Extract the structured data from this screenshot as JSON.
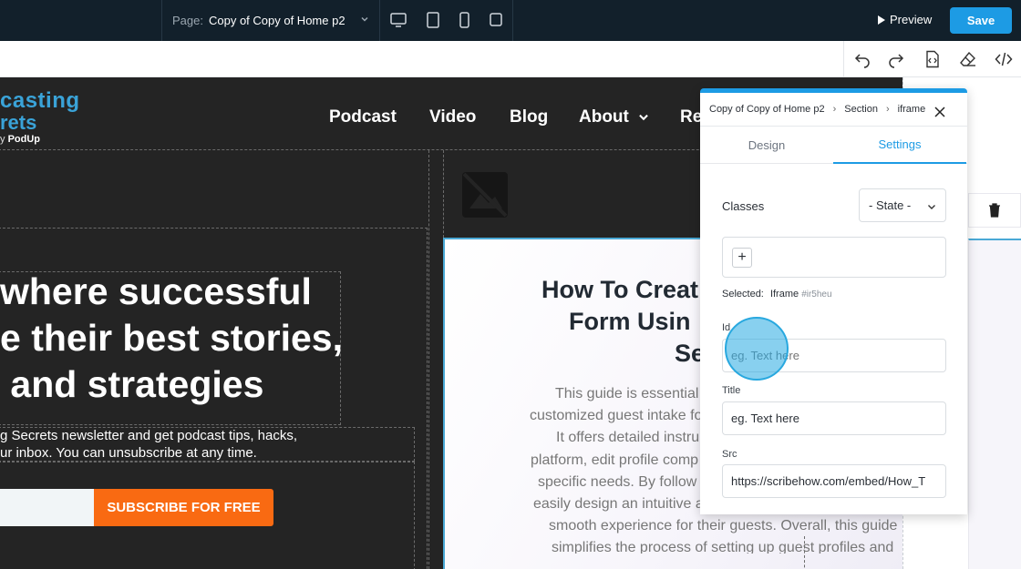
{
  "topbar": {
    "page_label": "Page:",
    "page_name": "Copy of Copy of Home p2",
    "preview_label": "Preview",
    "save_label": "Save"
  },
  "canvas": {
    "logo": {
      "line1": "casting",
      "line2": "rets",
      "line3_prefix": "y ",
      "line3_brand": "PodUp"
    },
    "nav": [
      "Podcast",
      "Video",
      "Blog",
      "About",
      "Re"
    ],
    "hero_lines": [
      "where successful",
      "e their best stories,",
      " and strategies"
    ],
    "sub_lines": [
      "g Secrets newsletter and get podcast tips, hacks,",
      "ur inbox. You can unsubscribe at any time."
    ],
    "subscribe_label": "SUBSCRIBE FOR FREE",
    "card": {
      "title_lines": [
        "How To Creat",
        "Form Usin",
        "Se"
      ],
      "body_lines": [
        "This guide is essential",
        "customized guest intake fo",
        "It offers detailed instru",
        "platform, edit profile comp",
        "specific needs. By follow",
        "easily design an intuitive a",
        "smooth experience for their guests. Overall, this guide",
        "simplifies the process of setting up guest profiles and"
      ]
    }
  },
  "panel": {
    "breadcrumb": [
      "Copy of Copy of Home p2",
      "Section",
      "iframe"
    ],
    "tabs": {
      "design": "Design",
      "settings": "Settings"
    },
    "classes_label": "Classes",
    "state_value": "- State -",
    "plus_label": "+",
    "selected_label": "Selected:",
    "selected_value": "Iframe",
    "selected_tag": "#ir5heu",
    "id": {
      "label": "Id",
      "placeholder": "eg. Text here"
    },
    "title": {
      "label": "Title",
      "value": "eg. Text here"
    },
    "src": {
      "label": "Src",
      "value": "https://scribehow.com/embed/How_T"
    }
  },
  "colors": {
    "accent": "#1d9be4",
    "topbar": "#12202b",
    "canvas": "#242424",
    "subscribe": "#f96a12",
    "logo": "#3aa3d8"
  }
}
